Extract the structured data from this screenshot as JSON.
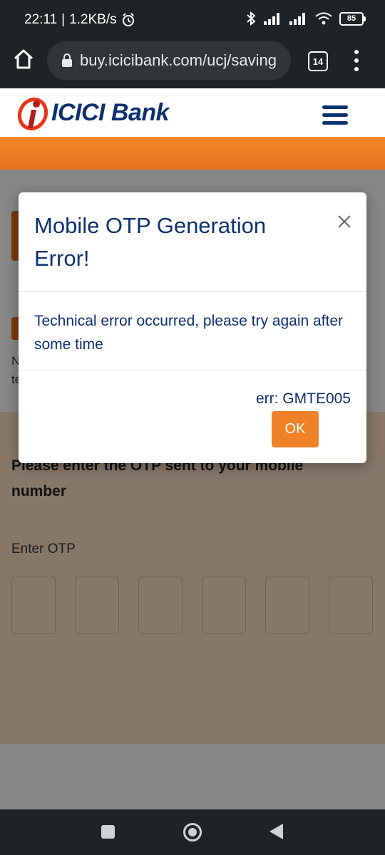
{
  "status_bar": {
    "time": "22:11",
    "network_speed": "1.2KB/s",
    "battery": "85"
  },
  "browser": {
    "url": "buy.icicibank.com/ucj/saving",
    "tab_count": "14"
  },
  "site": {
    "logo_text": "ICICI Bank",
    "brand_color": "#0d3170",
    "accent_color": "#ef8228"
  },
  "page": {
    "otp_prompt": "Please enter the OTP sent to your mobile number",
    "otp_label": "Enter OTP",
    "frag_line1": "N",
    "frag_line2": "te"
  },
  "modal": {
    "title": "Mobile OTP Generation Error!",
    "message": "Technical error occurred, please try again after some time",
    "error_code": "err: GMTE005",
    "ok_label": "OK"
  }
}
